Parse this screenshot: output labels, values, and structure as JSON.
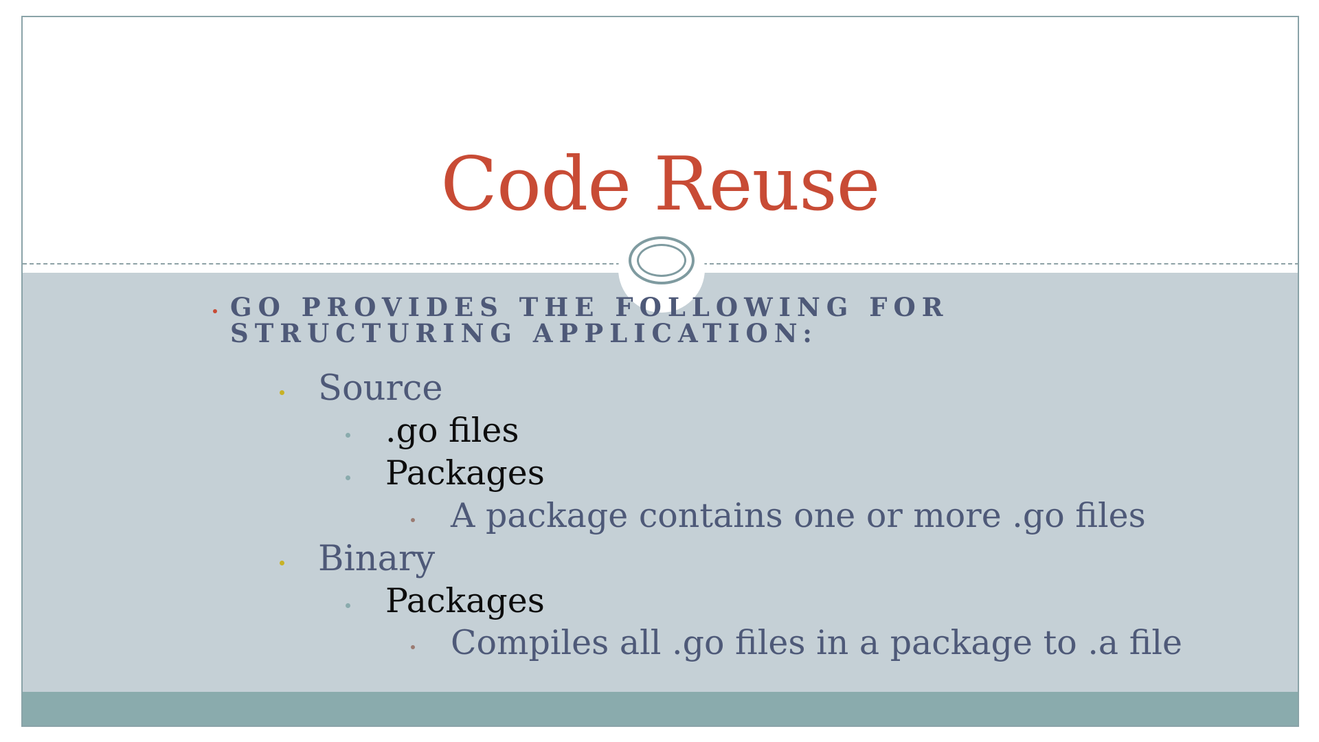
{
  "slide": {
    "title": "Code Reuse",
    "bullets": {
      "main": "GO PROVIDES THE FOLLOWING FOR STRUCTURING APPLICATION:",
      "source": "Source",
      "source_go_files": ".go files",
      "source_packages": "Packages",
      "source_packages_detail": "A package contains one or more .go files",
      "binary": "Binary",
      "binary_packages": "Packages",
      "binary_packages_detail": "Compiles all .go files in a package to .a file"
    }
  },
  "colors": {
    "title": "#c84b35",
    "content_background": "#c5d0d6",
    "footer_band": "#8aabad",
    "body_text": "#4e5978"
  }
}
